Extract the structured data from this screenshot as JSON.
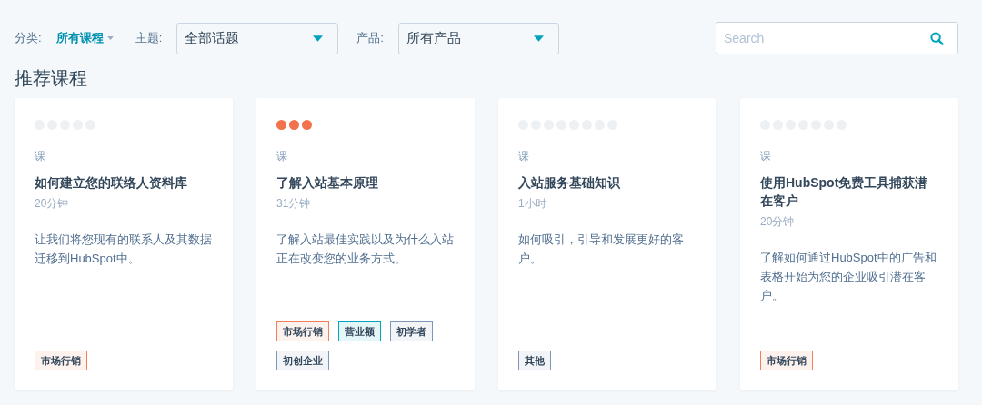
{
  "filters": {
    "category": {
      "label": "分类:",
      "value": "所有课程"
    },
    "topic": {
      "label": "主题:",
      "value": "全部话题"
    },
    "product": {
      "label": "产品:",
      "value": "所有产品"
    },
    "search": {
      "placeholder": "Search"
    }
  },
  "section_title": "推荐课程",
  "cards": [
    {
      "dots": [
        {
          "filled": false
        },
        {
          "filled": false
        },
        {
          "filled": false
        },
        {
          "filled": false
        },
        {
          "filled": false
        }
      ],
      "type": "课",
      "title": "如何建立您的联络人资料库",
      "duration": "20分钟",
      "description": "让我们将您现有的联系人及其数据迁移到HubSpot中。",
      "tags": [
        {
          "label": "市场行销",
          "color": "#f2805a"
        }
      ]
    },
    {
      "dots": [
        {
          "filled": true
        },
        {
          "filled": true
        },
        {
          "filled": true
        }
      ],
      "type": "课",
      "title": "了解入站基本原理",
      "duration": "31分钟",
      "description": "了解入站最佳实践以及为什么入站正在改变您的业务方式。",
      "tags": [
        {
          "label": "市场行销",
          "color": "#f2805a"
        },
        {
          "label": "营业额",
          "color": "#00a4bd"
        },
        {
          "label": "初学者",
          "color": "#7c98b6"
        },
        {
          "label": "初创企业",
          "color": "#7c98b6"
        }
      ]
    },
    {
      "dots": [
        {
          "filled": false
        },
        {
          "filled": false
        },
        {
          "filled": false
        },
        {
          "filled": false
        },
        {
          "filled": false
        },
        {
          "filled": false
        },
        {
          "filled": false
        },
        {
          "filled": false
        }
      ],
      "type": "课",
      "title": "入站服务基础知识",
      "duration": "1小时",
      "description": "如何吸引，引导和发展更好的客户。",
      "tags": [
        {
          "label": "其他",
          "color": "#7c98b6"
        }
      ]
    },
    {
      "dots": [
        {
          "filled": false
        },
        {
          "filled": false
        },
        {
          "filled": false
        },
        {
          "filled": false
        },
        {
          "filled": false
        },
        {
          "filled": false
        },
        {
          "filled": false
        }
      ],
      "type": "课",
      "title": "使用HubSpot免费工具捕获潜在客户",
      "duration": "20分钟",
      "description": "了解如何通过HubSpot中的广告和表格开始为您的企业吸引潜在客户。",
      "tags": [
        {
          "label": "市场行销",
          "color": "#f2805a"
        }
      ]
    }
  ]
}
